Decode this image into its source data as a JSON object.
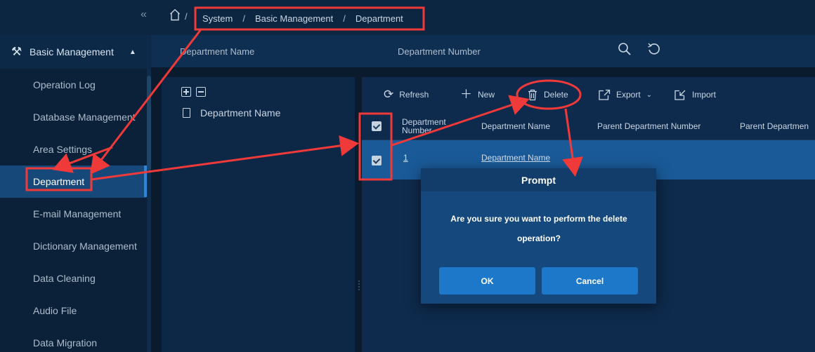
{
  "sidebar": {
    "collapse_icon": "double-chevron-left",
    "group_title": "Basic Management",
    "group_icon": "wrench-icon",
    "items": [
      {
        "label": "Operation Log"
      },
      {
        "label": "Database Management"
      },
      {
        "label": "Area Settings"
      },
      {
        "label": "Department"
      },
      {
        "label": "E-mail Management"
      },
      {
        "label": "Dictionary Management"
      },
      {
        "label": "Data Cleaning"
      },
      {
        "label": "Audio File"
      },
      {
        "label": "Data Migration"
      }
    ],
    "active_item": "Department"
  },
  "breadcrumb": {
    "home_sep": "/",
    "items": [
      "System",
      "Basic Management",
      "Department"
    ],
    "sep": "/"
  },
  "search": {
    "field1_label": "Department Name",
    "field2_label": "Department Number"
  },
  "tree": {
    "node_label": "Department Name"
  },
  "toolbar": {
    "refresh_label": "Refresh",
    "new_label": "New",
    "delete_label": "Delete",
    "export_label": "Export",
    "import_label": "Import"
  },
  "table": {
    "columns": [
      "Department Number",
      "Department Name",
      "Parent Department Number",
      "Parent Departmen"
    ],
    "rows": [
      {
        "number": "1",
        "name": "Department Name",
        "checked": true
      }
    ],
    "header_checked": true
  },
  "dialog": {
    "title": "Prompt",
    "message": "Are you sure you want to perform the delete operation?",
    "ok_label": "OK",
    "cancel_label": "Cancel"
  },
  "colors": {
    "background": "#0b1b2e",
    "sidebar": "#0a2139",
    "active_item": "#16497a",
    "selected_row": "#1a5a98",
    "dialog": "#15487c",
    "primary_button": "#1e78c9",
    "annotation": "#f03a3a"
  }
}
